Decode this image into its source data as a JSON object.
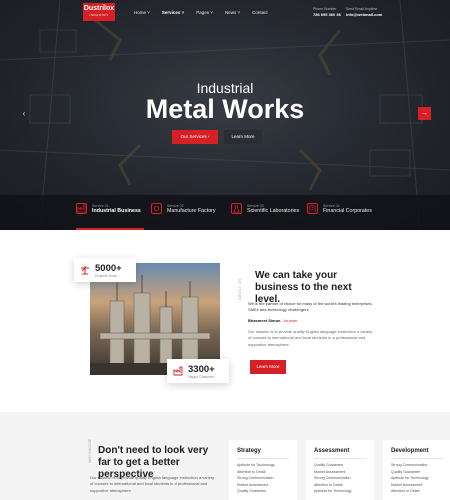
{
  "brand": {
    "name": "Dustrilox",
    "tagline": "INDUSTRY",
    "accent": "#d71f26"
  },
  "nav": {
    "items": [
      "Home ˅",
      "Services ˅",
      "Pages ˅",
      "News ˅",
      "Contact"
    ]
  },
  "contact": {
    "phone_label": "Phone Number",
    "phone": "786 695 360 36",
    "email_label": "Send Email Anytime",
    "email": "info@webmail.com"
  },
  "hero": {
    "title_small": "Industrial",
    "title_big": "Metal Works",
    "primary_button": "Our Services  ›",
    "secondary_button": "Learn More",
    "prev_arrow": "‹",
    "next_arrow": "→"
  },
  "services": [
    {
      "number": "Service 01",
      "label": "Industrial Business",
      "icon": "factory-icon",
      "active": true
    },
    {
      "number": "Service 02",
      "label": "Manufacture Factory",
      "icon": "gear-icon"
    },
    {
      "number": "Service 03",
      "label": "Scientific Laboratories",
      "icon": "flask-icon"
    },
    {
      "number": "Service 04",
      "label": "Financial Corporates",
      "icon": "building-icon"
    }
  ],
  "about": {
    "stat1": {
      "value": "5000+",
      "caption": "Projects Done",
      "icon": "crane-icon"
    },
    "stat2": {
      "value": "3300+",
      "caption": "Happy Customer",
      "icon": "factory-icon"
    },
    "vertical_label": "ABOUT US",
    "heading": "We can take your business to the next level.",
    "intro": "We is the partner of choice for many of the world's leading enterprises, SMEs and technology challengers.",
    "author_name": "Bhasmeet Simon",
    "author_role": "- founder",
    "body": "Our mission is to provide quality English language instruction a variety of courses to international and local students in a professional and supportive atmosphere.",
    "button": "Learn More"
  },
  "bottom": {
    "vertical_label": "WHY CHOOSE",
    "heading": "Don't need to look very far to get a better perspective",
    "body": "Our mission is to provide quality English language instruction a variety of courses to international and local students in a professional and supportive atmosphere.",
    "columns": [
      {
        "title": "Strategy",
        "items": [
          "Aptitude for Technology",
          "Attention to Detail",
          "Strong Communication",
          "Market Assessment",
          "Quality Guarantee"
        ]
      },
      {
        "title": "Assessment",
        "items": [
          "Quality Guarantee",
          "Market Assessment",
          "Strong Communication",
          "Attention to Detail",
          "Aptitude for Technology"
        ]
      },
      {
        "title": "Development",
        "items": [
          "Strong Communication",
          "Quality Guarantee",
          "Aptitude for Technology",
          "Market Assessment",
          "Attention to Detail"
        ]
      }
    ]
  }
}
